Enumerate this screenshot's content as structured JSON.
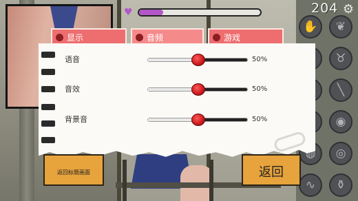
{
  "hud": {
    "hp_percent": 0.2,
    "counter": "204",
    "heart_icon": "heart-icon",
    "gear_icon": "gear-icon",
    "hp_color": "#b256c8"
  },
  "tabs": [
    {
      "label": "显示",
      "active": false
    },
    {
      "label": "音频",
      "active": true
    },
    {
      "label": "游戏",
      "active": false
    }
  ],
  "audio": {
    "rows": [
      {
        "label": "语音",
        "value_text": "50%",
        "value": 0.5
      },
      {
        "label": "音效",
        "value_text": "50%",
        "value": 0.5
      },
      {
        "label": "背景音",
        "value_text": "50%",
        "value": 0.5
      }
    ]
  },
  "buttons": {
    "return_title": "返回标题画面",
    "back": "返回"
  },
  "tools": [
    "hand-icon",
    "leaf-icon",
    "egg-icon",
    "uterus-icon",
    "circle-icon",
    "stick-icon",
    "shell-icon",
    "bubble-icon",
    "blob-icon",
    "bottle-icon"
  ],
  "colors": {
    "tab": "#ee6e70",
    "button": "#e7a33c",
    "knob": "#c8181c"
  }
}
